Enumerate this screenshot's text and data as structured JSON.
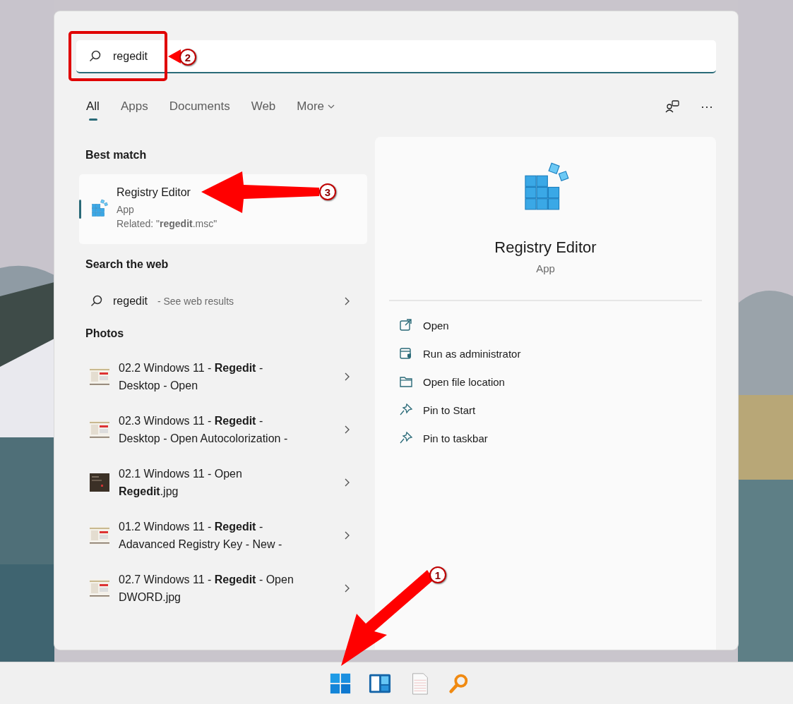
{
  "search": {
    "value": "regedit",
    "highlighted": true
  },
  "tabs": [
    {
      "label": "All",
      "selected": true
    },
    {
      "label": "Apps",
      "selected": false
    },
    {
      "label": "Documents",
      "selected": false
    },
    {
      "label": "Web",
      "selected": false
    },
    {
      "label": "More",
      "selected": false,
      "kind": "dropdown"
    }
  ],
  "toolbar": [
    {
      "kind": "people"
    },
    {
      "kind": "more",
      "label": "···"
    }
  ],
  "best_match": {
    "heading": "Best match",
    "title": "Registry Editor",
    "type": "App",
    "related": "Related: \"**regedit**.msc\"",
    "selected": true
  },
  "web": {
    "heading": "Search the web",
    "query": "regedit",
    "suffix": "- See web results"
  },
  "photos": {
    "heading": "Photos",
    "items": [
      {
        "lines": [
          "02.2 Windows 11 - **Regedit** -",
          "Desktop - Open"
        ],
        "kind": "light"
      },
      {
        "lines": [
          "02.3 Windows 11 - **Regedit** -",
          "Desktop - Open Autocolorization -"
        ],
        "kind": "light"
      },
      {
        "lines": [
          "02.1 Windows 11 - Open",
          "**Regedit**.jpg"
        ],
        "kind": "dark"
      },
      {
        "lines": [
          "01.2 Windows 11 - **Regedit** -",
          "Adavanced Registry Key - New -"
        ],
        "kind": "light"
      },
      {
        "lines": [
          "02.7 Windows 11 - **Regedit** - Open",
          "DWORD.jpg"
        ],
        "kind": "light"
      }
    ]
  },
  "details": {
    "title": "Registry Editor",
    "type": "App",
    "actions": [
      {
        "label": "Open",
        "kind": "open"
      },
      {
        "label": "Run as administrator",
        "kind": "admin"
      },
      {
        "label": "Open file location",
        "kind": "folder"
      },
      {
        "label": "Pin to Start",
        "kind": "pin"
      },
      {
        "label": "Pin to taskbar",
        "kind": "pin"
      }
    ]
  },
  "taskbar": [
    {
      "kind": "start"
    },
    {
      "kind": "widgets"
    },
    {
      "kind": "notepad"
    },
    {
      "kind": "magnifier"
    }
  ],
  "annotations": [
    {
      "number": "1",
      "kind": "taskbar"
    },
    {
      "number": "2",
      "kind": "search"
    },
    {
      "number": "3",
      "kind": "result"
    }
  ]
}
